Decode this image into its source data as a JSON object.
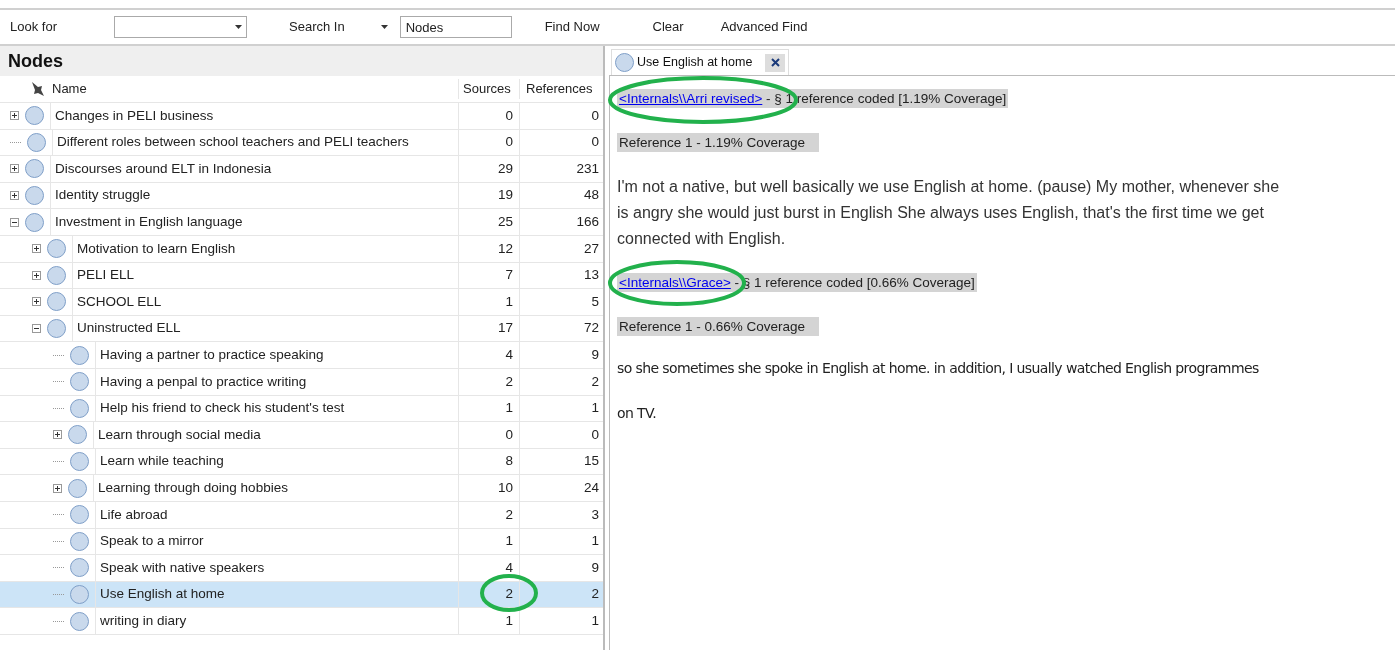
{
  "toolbar": {
    "look_for_label": "Look for",
    "search_in_label": "Search In",
    "search_in_value": "Nodes",
    "buttons": [
      "Find Now",
      "Clear",
      "Advanced Find"
    ]
  },
  "nodes_panel": {
    "title": "Nodes",
    "columns": [
      "Name",
      "Sources",
      "References"
    ],
    "rows": [
      {
        "name": "Changes in PELI business",
        "sources": "0",
        "references": "0",
        "expanded": false,
        "selected": false
      },
      {
        "name": "Different roles between school teachers and PELI teachers",
        "sources": "0",
        "references": "0",
        "selected": false
      },
      {
        "name": "Discourses around ELT in Indonesia",
        "sources": "29",
        "references": "231",
        "expanded": false,
        "selected": false
      },
      {
        "name": "Identity struggle",
        "sources": "19",
        "references": "48",
        "expanded": false,
        "selected": false
      },
      {
        "name": "Investment in English language",
        "sources": "25",
        "references": "166",
        "expanded": true,
        "selected": false,
        "children": [
          {
            "name": "Motivation to learn English",
            "sources": "12",
            "references": "27",
            "expanded": false,
            "selected": false
          },
          {
            "name": "PELI ELL",
            "sources": "7",
            "references": "13",
            "expanded": false,
            "selected": false
          },
          {
            "name": "SCHOOL ELL",
            "sources": "1",
            "references": "5",
            "expanded": false,
            "selected": false
          },
          {
            "name": "Uninstructed ELL",
            "sources": "17",
            "references": "72",
            "expanded": true,
            "selected": false,
            "children": [
              {
                "name": "Having a partner to practice speaking",
                "sources": "4",
                "references": "9",
                "selected": false
              },
              {
                "name": "Having a penpal to practice writing",
                "sources": "2",
                "references": "2",
                "selected": false
              },
              {
                "name": "Help his friend to check his student's test",
                "sources": "1",
                "references": "1",
                "selected": false
              },
              {
                "name": "Learn through social media",
                "sources": "0",
                "references": "0",
                "expanded": false,
                "selected": false
              },
              {
                "name": "Learn while teaching",
                "sources": "8",
                "references": "15",
                "selected": false
              },
              {
                "name": "Learning through doing hobbies",
                "sources": "10",
                "references": "24",
                "expanded": false,
                "selected": false
              },
              {
                "name": "Life abroad",
                "sources": "2",
                "references": "3",
                "selected": false
              },
              {
                "name": "Speak to a mirror",
                "sources": "1",
                "references": "1",
                "selected": false
              },
              {
                "name": "Speak with native speakers",
                "sources": "4",
                "references": "9",
                "selected": false
              },
              {
                "name": "Use English at home",
                "sources": "2",
                "references": "2",
                "selected": true
              },
              {
                "name": "writing in diary",
                "sources": "1",
                "references": "1",
                "selected": false
              }
            ]
          }
        ]
      }
    ]
  },
  "detail": {
    "tab": {
      "label": "Use English at home"
    },
    "blocks": [
      {
        "kind": "source",
        "link": "<Internals\\\\Arri revised>",
        "text": "- § 1 reference coded  [1.19% Coverage]"
      },
      {
        "kind": "reference",
        "text": "Reference 1 - 1.19% Coverage"
      },
      {
        "kind": "passage",
        "text": "I'm not a native, but well basically we use English at home. (pause) My mother, whenever she is angry she would just burst in English She always uses English, that's the first time we get connected with English."
      },
      {
        "kind": "source",
        "link": "<Internals\\\\Grace>",
        "text": "- § 1 reference coded  [0.66% Coverage]"
      },
      {
        "kind": "reference",
        "text": "Reference 1 - 0.66% Coverage"
      },
      {
        "kind": "note",
        "text": "so she sometimes she spoke in English at home. in addition, I usually watched English programmes"
      },
      {
        "kind": "note",
        "text": "on TV."
      }
    ]
  }
}
